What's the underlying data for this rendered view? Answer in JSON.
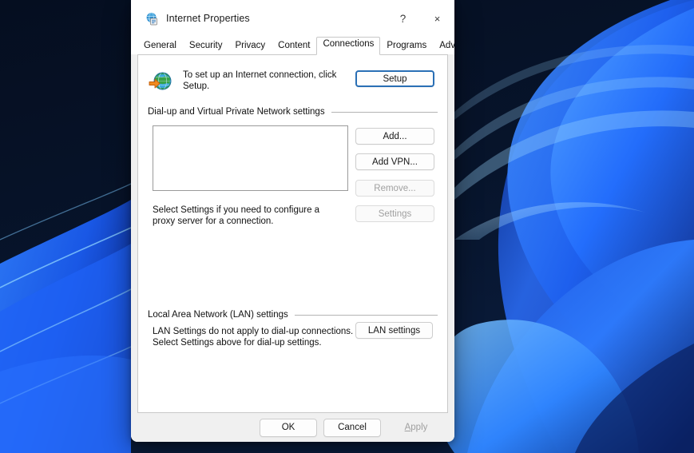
{
  "desktop": {
    "wallpaper_name": "windows-bloom-wallpaper",
    "colors": {
      "sky_dark": "#061024",
      "sky_mid": "#0a1a36",
      "ribbon_bright": "#2f7dff",
      "ribbon_light": "#56a8ff",
      "ribbon_deep": "#1b3faf",
      "ribbon_edge": "#7fd0ff"
    }
  },
  "dialog": {
    "title": "Internet Properties",
    "title_icon": "internet-properties-icon",
    "caption": {
      "help": "?",
      "close": "×"
    },
    "tabs": [
      {
        "label": "General",
        "selected": false
      },
      {
        "label": "Security",
        "selected": false
      },
      {
        "label": "Privacy",
        "selected": false
      },
      {
        "label": "Content",
        "selected": false
      },
      {
        "label": "Connections",
        "selected": true
      },
      {
        "label": "Programs",
        "selected": false
      },
      {
        "label": "Advanced",
        "selected": false
      }
    ],
    "connections": {
      "setup_row": {
        "icon": "globe-with-arrow-icon",
        "text": "To set up an Internet connection, click Setup.",
        "button": {
          "label": "Setup",
          "state": "accent"
        }
      },
      "dialup_group": {
        "header": "Dial-up and Virtual Private Network settings",
        "listbox_items": [],
        "buttons": [
          {
            "label": "Add...",
            "state": "enabled"
          },
          {
            "label": "Add VPN...",
            "state": "enabled"
          },
          {
            "label": "Remove...",
            "state": "disabled"
          },
          {
            "label": "Settings",
            "state": "disabled"
          }
        ],
        "hint": "Select Settings if you need to configure a proxy server for a connection."
      },
      "lan_group": {
        "header": "Local Area Network (LAN) settings",
        "text": "LAN Settings do not apply to dial-up connections. Select Settings above for dial-up settings.",
        "button": {
          "label": "LAN settings",
          "state": "enabled"
        }
      }
    },
    "footer": {
      "buttons": [
        {
          "label": "OK",
          "state": "enabled"
        },
        {
          "label": "Cancel",
          "state": "enabled"
        },
        {
          "label": "Apply",
          "state": "disabled",
          "accel": "A",
          "rest": "pply"
        }
      ]
    }
  }
}
